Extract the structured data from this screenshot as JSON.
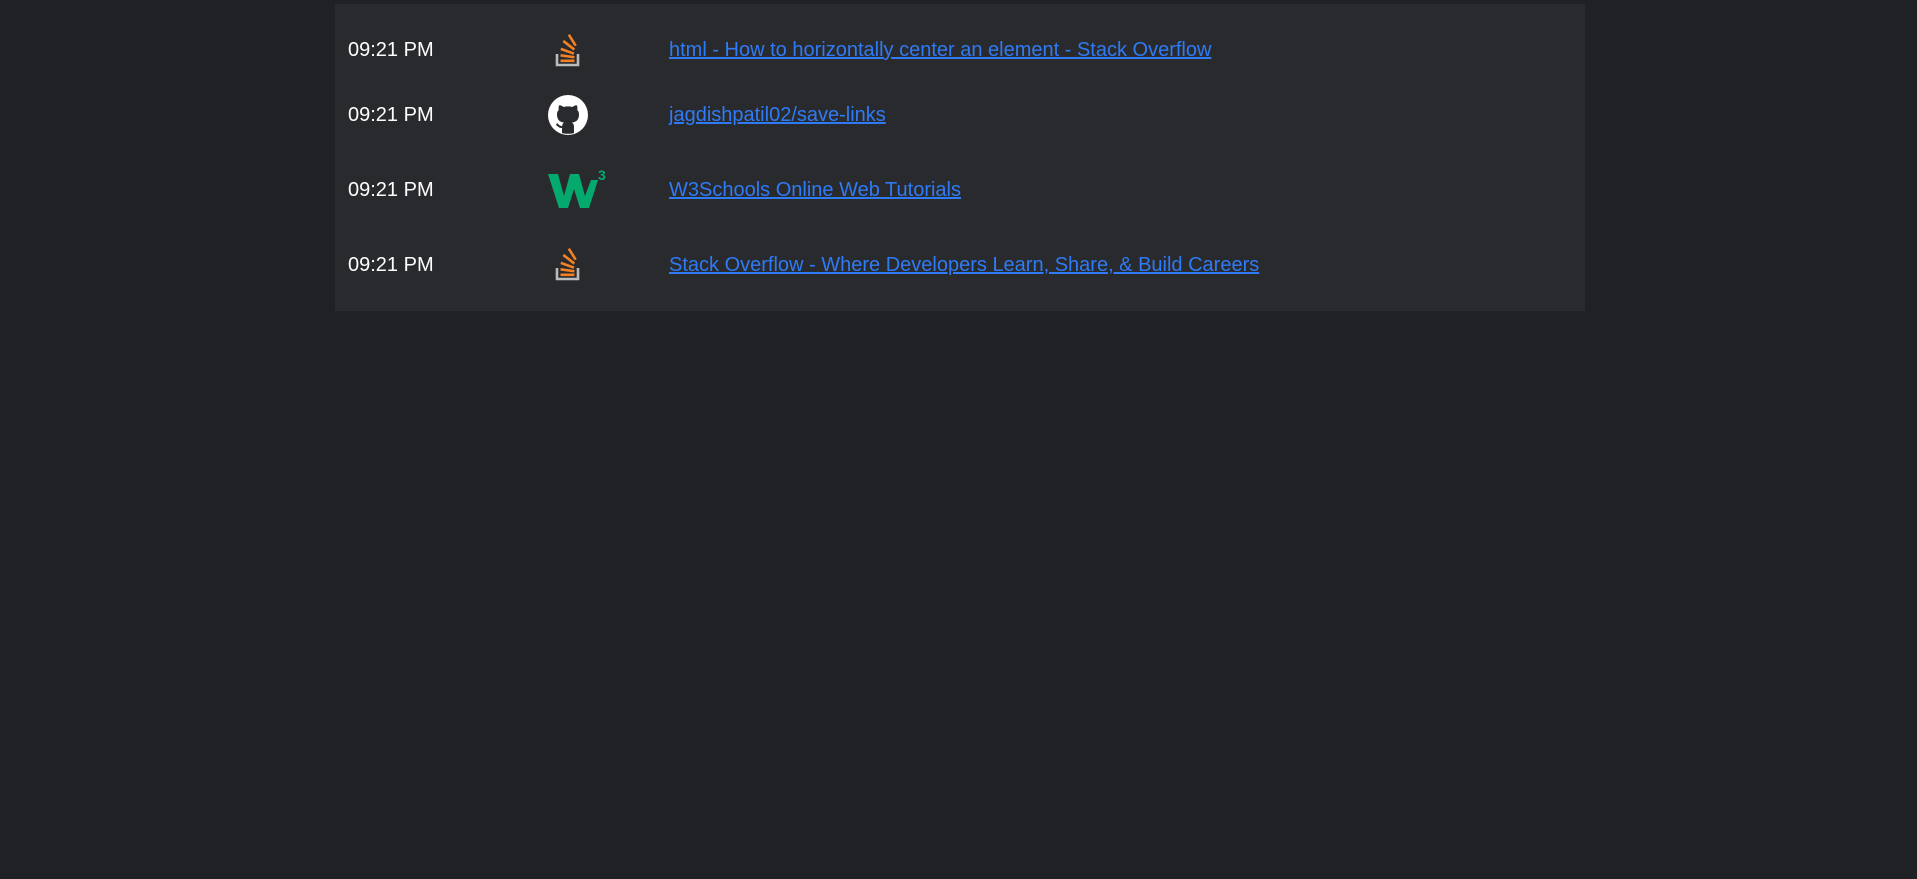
{
  "links": [
    {
      "time": "09:21 PM",
      "icon": "stackoverflow-icon",
      "title": "html - How to horizontally center an element - Stack Overflow"
    },
    {
      "time": "09:21 PM",
      "icon": "github-icon",
      "title": "jagdishpatil02/save-links"
    },
    {
      "time": "09:21 PM",
      "icon": "w3schools-icon",
      "title": "W3Schools Online Web Tutorials"
    },
    {
      "time": "09:21 PM",
      "icon": "stackoverflow-icon",
      "title": "Stack Overflow - Where Developers Learn, Share, & Build Careers"
    }
  ],
  "colors": {
    "background": "#202124",
    "panel": "#292a2d",
    "link": "#2f7bf5",
    "text": "#ffffff",
    "stackoverflow_orange": "#f48024",
    "stackoverflow_gray": "#bcbbbb",
    "w3schools_green": "#04aa6d"
  }
}
